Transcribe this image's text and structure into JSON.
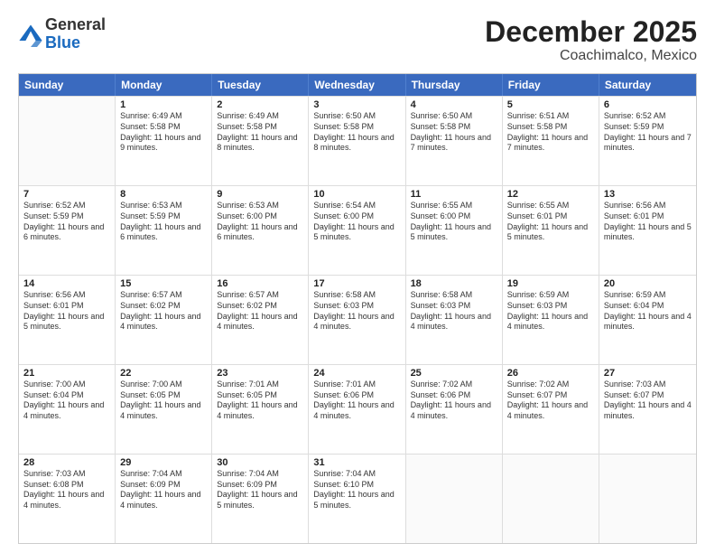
{
  "logo": {
    "general": "General",
    "blue": "Blue"
  },
  "header": {
    "month": "December 2025",
    "location": "Coachimalco, Mexico"
  },
  "days": [
    "Sunday",
    "Monday",
    "Tuesday",
    "Wednesday",
    "Thursday",
    "Friday",
    "Saturday"
  ],
  "rows": [
    [
      {
        "day": "",
        "sunrise": "",
        "sunset": "",
        "daylight": ""
      },
      {
        "day": "1",
        "sunrise": "Sunrise: 6:49 AM",
        "sunset": "Sunset: 5:58 PM",
        "daylight": "Daylight: 11 hours and 9 minutes."
      },
      {
        "day": "2",
        "sunrise": "Sunrise: 6:49 AM",
        "sunset": "Sunset: 5:58 PM",
        "daylight": "Daylight: 11 hours and 8 minutes."
      },
      {
        "day": "3",
        "sunrise": "Sunrise: 6:50 AM",
        "sunset": "Sunset: 5:58 PM",
        "daylight": "Daylight: 11 hours and 8 minutes."
      },
      {
        "day": "4",
        "sunrise": "Sunrise: 6:50 AM",
        "sunset": "Sunset: 5:58 PM",
        "daylight": "Daylight: 11 hours and 7 minutes."
      },
      {
        "day": "5",
        "sunrise": "Sunrise: 6:51 AM",
        "sunset": "Sunset: 5:58 PM",
        "daylight": "Daylight: 11 hours and 7 minutes."
      },
      {
        "day": "6",
        "sunrise": "Sunrise: 6:52 AM",
        "sunset": "Sunset: 5:59 PM",
        "daylight": "Daylight: 11 hours and 7 minutes."
      }
    ],
    [
      {
        "day": "7",
        "sunrise": "Sunrise: 6:52 AM",
        "sunset": "Sunset: 5:59 PM",
        "daylight": "Daylight: 11 hours and 6 minutes."
      },
      {
        "day": "8",
        "sunrise": "Sunrise: 6:53 AM",
        "sunset": "Sunset: 5:59 PM",
        "daylight": "Daylight: 11 hours and 6 minutes."
      },
      {
        "day": "9",
        "sunrise": "Sunrise: 6:53 AM",
        "sunset": "Sunset: 6:00 PM",
        "daylight": "Daylight: 11 hours and 6 minutes."
      },
      {
        "day": "10",
        "sunrise": "Sunrise: 6:54 AM",
        "sunset": "Sunset: 6:00 PM",
        "daylight": "Daylight: 11 hours and 5 minutes."
      },
      {
        "day": "11",
        "sunrise": "Sunrise: 6:55 AM",
        "sunset": "Sunset: 6:00 PM",
        "daylight": "Daylight: 11 hours and 5 minutes."
      },
      {
        "day": "12",
        "sunrise": "Sunrise: 6:55 AM",
        "sunset": "Sunset: 6:01 PM",
        "daylight": "Daylight: 11 hours and 5 minutes."
      },
      {
        "day": "13",
        "sunrise": "Sunrise: 6:56 AM",
        "sunset": "Sunset: 6:01 PM",
        "daylight": "Daylight: 11 hours and 5 minutes."
      }
    ],
    [
      {
        "day": "14",
        "sunrise": "Sunrise: 6:56 AM",
        "sunset": "Sunset: 6:01 PM",
        "daylight": "Daylight: 11 hours and 5 minutes."
      },
      {
        "day": "15",
        "sunrise": "Sunrise: 6:57 AM",
        "sunset": "Sunset: 6:02 PM",
        "daylight": "Daylight: 11 hours and 4 minutes."
      },
      {
        "day": "16",
        "sunrise": "Sunrise: 6:57 AM",
        "sunset": "Sunset: 6:02 PM",
        "daylight": "Daylight: 11 hours and 4 minutes."
      },
      {
        "day": "17",
        "sunrise": "Sunrise: 6:58 AM",
        "sunset": "Sunset: 6:03 PM",
        "daylight": "Daylight: 11 hours and 4 minutes."
      },
      {
        "day": "18",
        "sunrise": "Sunrise: 6:58 AM",
        "sunset": "Sunset: 6:03 PM",
        "daylight": "Daylight: 11 hours and 4 minutes."
      },
      {
        "day": "19",
        "sunrise": "Sunrise: 6:59 AM",
        "sunset": "Sunset: 6:03 PM",
        "daylight": "Daylight: 11 hours and 4 minutes."
      },
      {
        "day": "20",
        "sunrise": "Sunrise: 6:59 AM",
        "sunset": "Sunset: 6:04 PM",
        "daylight": "Daylight: 11 hours and 4 minutes."
      }
    ],
    [
      {
        "day": "21",
        "sunrise": "Sunrise: 7:00 AM",
        "sunset": "Sunset: 6:04 PM",
        "daylight": "Daylight: 11 hours and 4 minutes."
      },
      {
        "day": "22",
        "sunrise": "Sunrise: 7:00 AM",
        "sunset": "Sunset: 6:05 PM",
        "daylight": "Daylight: 11 hours and 4 minutes."
      },
      {
        "day": "23",
        "sunrise": "Sunrise: 7:01 AM",
        "sunset": "Sunset: 6:05 PM",
        "daylight": "Daylight: 11 hours and 4 minutes."
      },
      {
        "day": "24",
        "sunrise": "Sunrise: 7:01 AM",
        "sunset": "Sunset: 6:06 PM",
        "daylight": "Daylight: 11 hours and 4 minutes."
      },
      {
        "day": "25",
        "sunrise": "Sunrise: 7:02 AM",
        "sunset": "Sunset: 6:06 PM",
        "daylight": "Daylight: 11 hours and 4 minutes."
      },
      {
        "day": "26",
        "sunrise": "Sunrise: 7:02 AM",
        "sunset": "Sunset: 6:07 PM",
        "daylight": "Daylight: 11 hours and 4 minutes."
      },
      {
        "day": "27",
        "sunrise": "Sunrise: 7:03 AM",
        "sunset": "Sunset: 6:07 PM",
        "daylight": "Daylight: 11 hours and 4 minutes."
      }
    ],
    [
      {
        "day": "28",
        "sunrise": "Sunrise: 7:03 AM",
        "sunset": "Sunset: 6:08 PM",
        "daylight": "Daylight: 11 hours and 4 minutes."
      },
      {
        "day": "29",
        "sunrise": "Sunrise: 7:04 AM",
        "sunset": "Sunset: 6:09 PM",
        "daylight": "Daylight: 11 hours and 4 minutes."
      },
      {
        "day": "30",
        "sunrise": "Sunrise: 7:04 AM",
        "sunset": "Sunset: 6:09 PM",
        "daylight": "Daylight: 11 hours and 5 minutes."
      },
      {
        "day": "31",
        "sunrise": "Sunrise: 7:04 AM",
        "sunset": "Sunset: 6:10 PM",
        "daylight": "Daylight: 11 hours and 5 minutes."
      },
      {
        "day": "",
        "sunrise": "",
        "sunset": "",
        "daylight": ""
      },
      {
        "day": "",
        "sunrise": "",
        "sunset": "",
        "daylight": ""
      },
      {
        "day": "",
        "sunrise": "",
        "sunset": "",
        "daylight": ""
      }
    ]
  ]
}
